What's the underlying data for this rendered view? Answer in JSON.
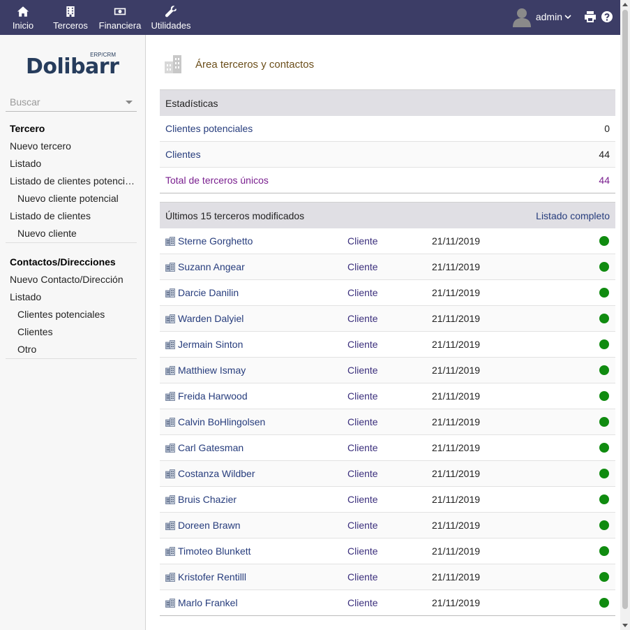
{
  "topmenu": {
    "items": [
      {
        "label": "Inicio",
        "icon": "home-icon"
      },
      {
        "label": "Terceros",
        "icon": "building-icon"
      },
      {
        "label": "Financiera",
        "icon": "money-icon"
      },
      {
        "label": "Utilidades",
        "icon": "wrench-icon"
      }
    ],
    "active": "Terceros",
    "user": "admin"
  },
  "logo": {
    "text": "Dolibarr",
    "sub": "ERP/CRM"
  },
  "search": {
    "placeholder": "Buscar"
  },
  "leftmenu": {
    "block1": {
      "title": "Tercero",
      "items": [
        "Nuevo tercero",
        "Listado",
        "Listado de clientes potenciales",
        "Nuevo cliente potencial",
        "Listado de clientes",
        "Nuevo cliente"
      ]
    },
    "block2": {
      "title": "Contactos/Direcciones",
      "items": [
        "Nuevo Contacto/Dirección",
        "Listado",
        "Clientes potenciales",
        "Clientes",
        "Otro"
      ]
    }
  },
  "page": {
    "title": "Área terceros y contactos"
  },
  "stats": {
    "title": "Estadísticas",
    "rows": [
      {
        "label": "Clientes potenciales",
        "value": "0"
      },
      {
        "label": "Clientes",
        "value": "44"
      },
      {
        "label": "Total de terceros únicos",
        "value": "44"
      }
    ]
  },
  "recent": {
    "title": "Últimos 15 terceros modificados",
    "link": "Listado completo",
    "rows": [
      {
        "name": "Sterne Gorghetto",
        "type": "Cliente",
        "date": "21/11/2019",
        "status": "#108b10"
      },
      {
        "name": "Suzann Angear",
        "type": "Cliente",
        "date": "21/11/2019",
        "status": "#108b10"
      },
      {
        "name": "Darcie Danilin",
        "type": "Cliente",
        "date": "21/11/2019",
        "status": "#108b10"
      },
      {
        "name": "Warden Dalyiel",
        "type": "Cliente",
        "date": "21/11/2019",
        "status": "#108b10"
      },
      {
        "name": "Jermain Sinton",
        "type": "Cliente",
        "date": "21/11/2019",
        "status": "#108b10"
      },
      {
        "name": "Matthiew Ismay",
        "type": "Cliente",
        "date": "21/11/2019",
        "status": "#108b10"
      },
      {
        "name": "Freida Harwood",
        "type": "Cliente",
        "date": "21/11/2019",
        "status": "#108b10"
      },
      {
        "name": "Calvin BoHlingolsen",
        "type": "Cliente",
        "date": "21/11/2019",
        "status": "#108b10"
      },
      {
        "name": "Carl Gatesman",
        "type": "Cliente",
        "date": "21/11/2019",
        "status": "#108b10"
      },
      {
        "name": "Costanza Wildber",
        "type": "Cliente",
        "date": "21/11/2019",
        "status": "#108b10"
      },
      {
        "name": "Bruis Chazier",
        "type": "Cliente",
        "date": "21/11/2019",
        "status": "#108b10"
      },
      {
        "name": "Doreen Brawn",
        "type": "Cliente",
        "date": "21/11/2019",
        "status": "#108b10"
      },
      {
        "name": "Timoteo Blunkett",
        "type": "Cliente",
        "date": "21/11/2019",
        "status": "#108b10"
      },
      {
        "name": "Kristofer Rentilll",
        "type": "Cliente",
        "date": "21/11/2019",
        "status": "#108b10"
      },
      {
        "name": "Marlo Frankel",
        "type": "Cliente",
        "date": "21/11/2019",
        "status": "#108b10"
      }
    ]
  },
  "colors": {
    "topbar": "#3c3d66",
    "link": "#263c7c",
    "total": "#7a1f8f",
    "status_ok": "#108b10"
  }
}
